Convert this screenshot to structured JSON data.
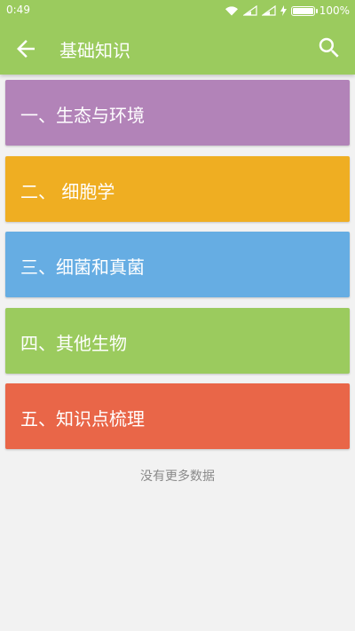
{
  "status_bar": {
    "time": "0:49",
    "battery_percent": "100%",
    "battery_level": 1.0,
    "icons": [
      "wifi-icon",
      "signal-icon",
      "signal-icon",
      "charging-icon",
      "battery-icon"
    ]
  },
  "toolbar": {
    "title": "基础知识",
    "back_icon": "arrow-left-icon",
    "search_icon": "search-icon",
    "background": "#9bcb5e"
  },
  "items": [
    {
      "label": "一、生态与环境",
      "color": "#b283b8"
    },
    {
      "label": "二、 细胞学",
      "color": "#efae22"
    },
    {
      "label": "三、细菌和真菌",
      "color": "#66ade3"
    },
    {
      "label": "四、其他生物",
      "color": "#9bcb5e"
    },
    {
      "label": "五、知识点梳理",
      "color": "#e96648"
    }
  ],
  "footer": {
    "text": "没有更多数据"
  }
}
